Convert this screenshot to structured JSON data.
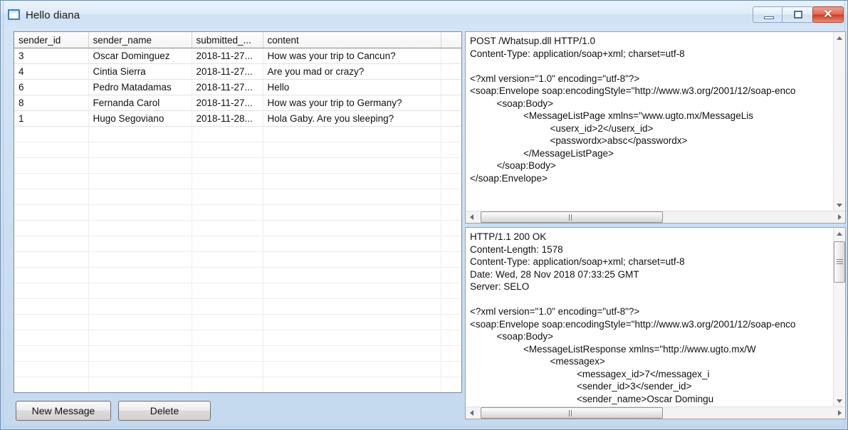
{
  "window": {
    "title": "Hello diana",
    "icon": "window-icon",
    "controls": {
      "minimize_label": "–",
      "maximize_label": "□",
      "close_label": "✕"
    }
  },
  "grid": {
    "columns": [
      "sender_id",
      "sender_name",
      "submitted_...",
      "content",
      ""
    ],
    "rows": [
      [
        "3",
        "Oscar Dominguez",
        "2018-11-27...",
        "How was your trip to Cancun?",
        ""
      ],
      [
        "4",
        "Cintia Sierra",
        "2018-11-27...",
        "Are you mad or crazy?",
        ""
      ],
      [
        "6",
        "Pedro Matadamas",
        "2018-11-27...",
        "Hello",
        ""
      ],
      [
        "8",
        "Fernanda Carol",
        "2018-11-27...",
        "How was your trip to Germany?",
        ""
      ],
      [
        "1",
        "Hugo Segoviano",
        "2018-11-28...",
        "Hola Gaby.  Are you sleeping?",
        ""
      ]
    ],
    "empty_row_count": 17
  },
  "buttons": {
    "new_message": "New Message",
    "delete": "Delete"
  },
  "request_pane": {
    "text": "POST /Whatsup.dll HTTP/1.0\nContent-Type: application/soap+xml; charset=utf-8\n\n<?xml version=\"1.0\" encoding=\"utf-8\"?>\n<soap:Envelope soap:encodingStyle=\"http://www.w3.org/2001/12/soap-enco\n          <soap:Body>\n                    <MessageListPage xmlns=\"www.ugto.mx/MessageLis\n                              <userx_id>2</userx_id>\n                              <passwordx>absc</passwordx>\n                    </MessageListPage>\n          </soap:Body>\n</soap:Envelope>"
  },
  "response_pane": {
    "text": "HTTP/1.1 200 OK\nContent-Length: 1578\nContent-Type: application/soap+xml; charset=utf-8\nDate: Wed, 28 Nov 2018 07:33:25 GMT\nServer: SELO\n\n<?xml version=\"1.0\" encoding=\"utf-8\"?>\n<soap:Envelope soap:encodingStyle=\"http://www.w3.org/2001/12/soap-enco\n          <soap:Body>\n                    <MessageListResponse xmlns=\"http://www.ugto.mx/W\n                              <messagex>\n                                        <messagex_id>7</messagex_i\n                                        <sender_id>3</sender_id>\n                                        <sender_name>Oscar Domingu"
  },
  "scrollbars": {
    "up_arrow": "scroll-up-arrow",
    "down_arrow": "scroll-down-arrow",
    "left_arrow": "scroll-left-arrow",
    "right_arrow": "scroll-right-arrow"
  },
  "colors": {
    "frame": "#6f8cad",
    "titlebar": "#dfecf9",
    "close_button": "#cf3b23",
    "client_background": "#cfe0f2"
  }
}
